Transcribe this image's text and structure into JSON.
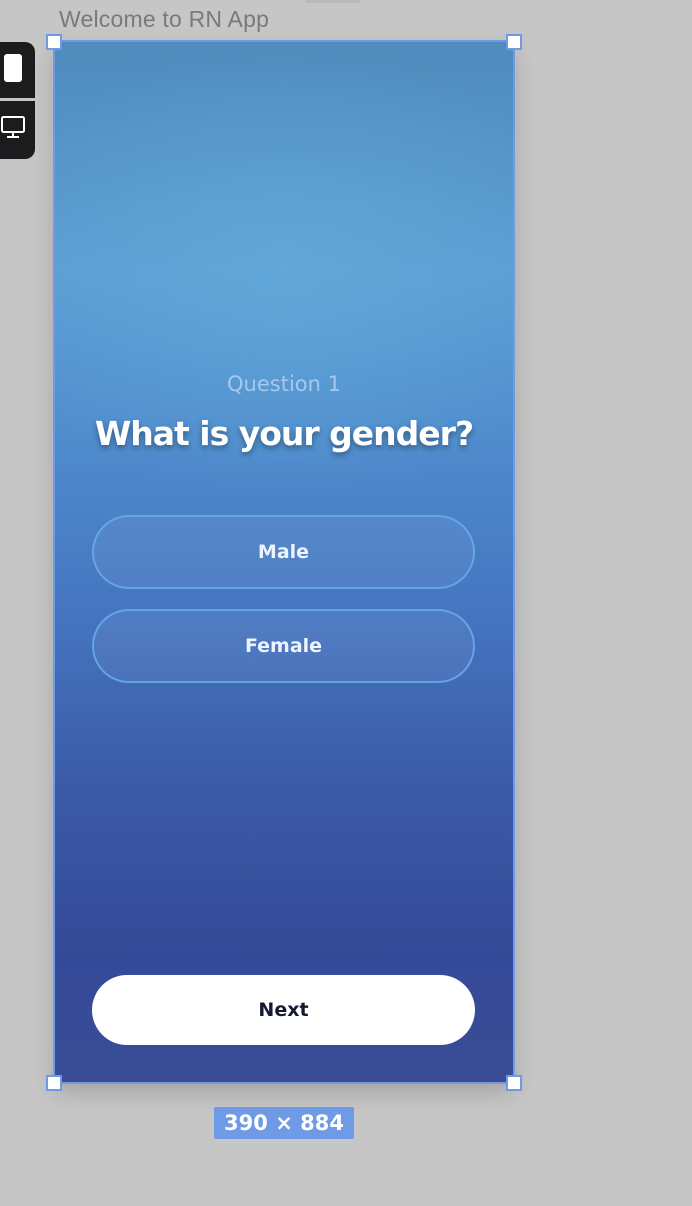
{
  "frame": {
    "label": "Welcome to RN App",
    "dimensions": "390 × 884"
  },
  "device_switcher": {
    "items": [
      {
        "icon": "phone-icon",
        "active": true
      },
      {
        "icon": "desktop-icon",
        "active": false
      }
    ]
  },
  "screen": {
    "question_label": "Question 1",
    "question_title": "What is your gender?",
    "options": [
      "Male",
      "Female"
    ],
    "next_label": "Next"
  },
  "colors": {
    "background": "#c6c6c6",
    "selection": "#6f9ae6",
    "gradient_top": "#5a9dd3",
    "gradient_bottom": "#344a98",
    "next_button_bg": "#ffffff",
    "next_button_text": "#151932"
  }
}
